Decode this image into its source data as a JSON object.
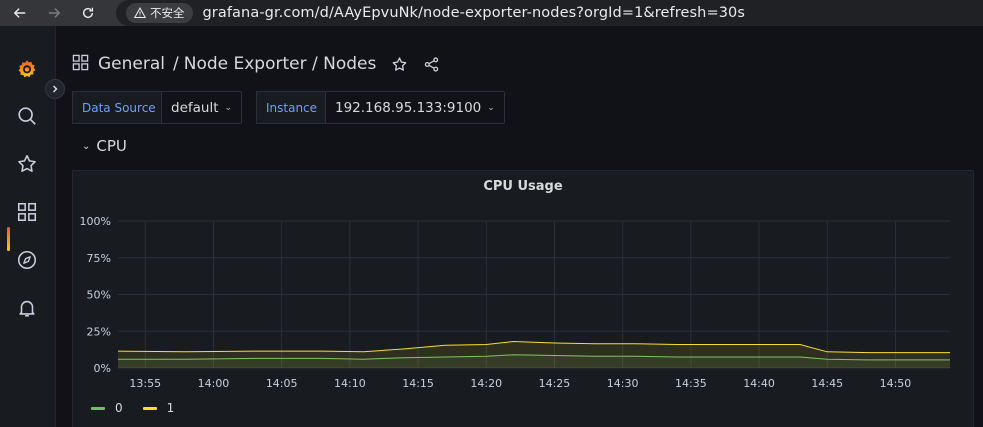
{
  "browser": {
    "security_label": "不安全",
    "url": "grafana-gr.com/d/AAyEpvuNk/node-exporter-nodes?orgId=1&refresh=30s"
  },
  "sidebar": {
    "items": [
      {
        "icon": "grafana-logo-icon"
      },
      {
        "icon": "search-icon"
      },
      {
        "icon": "star-icon"
      },
      {
        "icon": "dashboards-icon",
        "active": true
      },
      {
        "icon": "explore-compass-icon"
      },
      {
        "icon": "alerting-bell-icon"
      }
    ]
  },
  "header": {
    "folder": "General",
    "separator": "/",
    "title": "Node Exporter / Nodes"
  },
  "variables": [
    {
      "label": "Data Source",
      "value": "default"
    },
    {
      "label": "Instance",
      "value": "192.168.95.133:9100"
    }
  ],
  "row": {
    "title": "CPU"
  },
  "colors": {
    "series_0": "#73bf69",
    "series_1": "#fade2a",
    "accent": "#6e9fff"
  },
  "chart_data": {
    "type": "line",
    "title": "CPU Usage",
    "xlabel": "",
    "ylabel": "",
    "x_ticks": [
      "13:55",
      "14:00",
      "14:05",
      "14:10",
      "14:15",
      "14:20",
      "14:25",
      "14:30",
      "14:35",
      "14:40",
      "14:45",
      "14:50"
    ],
    "y_ticks": [
      "0%",
      "25%",
      "50%",
      "75%",
      "100%"
    ],
    "ylim": [
      0,
      100
    ],
    "xlim": [
      "13:53",
      "14:54"
    ],
    "x": [
      "13:53",
      "13:58",
      "14:03",
      "14:08",
      "14:11",
      "14:14",
      "14:17",
      "14:20",
      "14:22",
      "14:25",
      "14:28",
      "14:31",
      "14:34",
      "14:37",
      "14:40",
      "14:43",
      "14:45",
      "14:48",
      "14:51",
      "14:54"
    ],
    "series": [
      {
        "name": "0",
        "values": [
          6,
          6,
          6.5,
          6.5,
          6,
          7,
          7.5,
          8,
          9,
          8.5,
          8,
          8,
          7.5,
          7.5,
          7.5,
          7.5,
          6,
          5.5,
          5.5,
          5.5
        ]
      },
      {
        "name": "1",
        "values": [
          11.5,
          11,
          11.5,
          11.5,
          11,
          13,
          15.5,
          16,
          18,
          17,
          16.5,
          16.5,
          16,
          16,
          16,
          16,
          11,
          10.5,
          10.5,
          10.5
        ]
      }
    ],
    "grid": true,
    "legend": "bottom-left"
  }
}
